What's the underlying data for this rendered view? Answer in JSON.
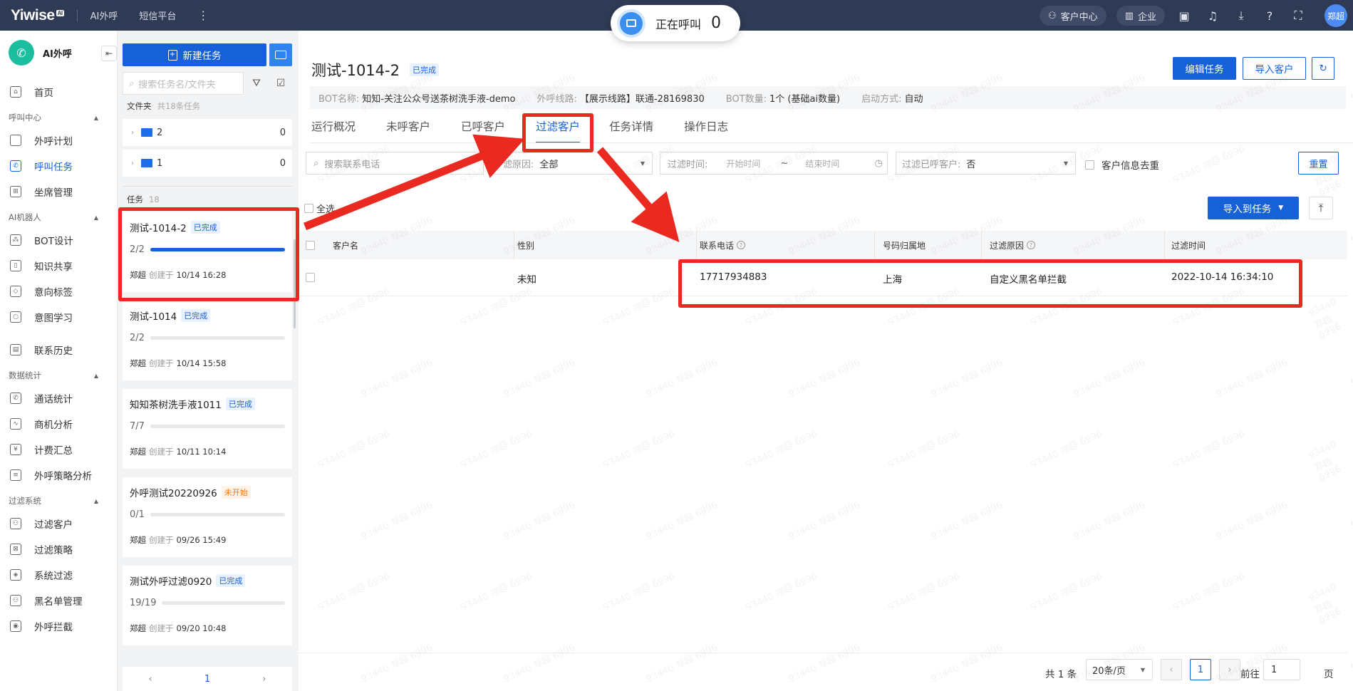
{
  "topbar": {
    "logo": "Yiwise",
    "logo_badge": "AI",
    "nav": [
      "AI外呼",
      "短信平台"
    ],
    "customer_center": "客户中心",
    "enterprise": "企业",
    "user": "郑超"
  },
  "call_status": {
    "label": "正在呼叫",
    "count": "0"
  },
  "sidebar": {
    "product": "AI外呼",
    "home": "首页",
    "groups": [
      {
        "label": "呼叫中心",
        "items": [
          "外呼计划",
          "呼叫任务",
          "坐席管理"
        ]
      },
      {
        "label": "AI机器人",
        "items": [
          "BOT设计",
          "知识共享",
          "意向标签",
          "意图学习"
        ]
      },
      {
        "label": "",
        "items": [
          "联系历史"
        ]
      },
      {
        "label": "数据统计",
        "items": [
          "通话统计",
          "商机分析",
          "计费汇总",
          "外呼策略分析"
        ]
      },
      {
        "label": "过滤系统",
        "items": [
          "过滤客户",
          "过滤策略",
          "系统过滤",
          "黑名单管理",
          "外呼拦截"
        ]
      }
    ],
    "active_item": "呼叫任务"
  },
  "task_panel": {
    "new_task": "新建任务",
    "search_placeholder": "搜索任务名/文件夹",
    "folder_label": "文件夹",
    "folder_count": "共18条任务",
    "folders": [
      {
        "name": "2",
        "count": "0"
      },
      {
        "name": "1",
        "count": "0"
      }
    ],
    "task_label": "任务",
    "task_count": "18",
    "tasks": [
      {
        "name": "测试-1014-2",
        "status": "已完成",
        "progress": "2/2",
        "ratio": 1.0,
        "creator": "郑超",
        "created_label": "创建于",
        "time": "10/14 16:28"
      },
      {
        "name": "测试-1014",
        "status": "已完成",
        "progress": "2/2",
        "ratio": 0.0,
        "creator": "郑超",
        "created_label": "创建于",
        "time": "10/14 15:58"
      },
      {
        "name": "知知茶树洗手液1011",
        "status": "已完成",
        "progress": "7/7",
        "ratio": 0.0,
        "creator": "郑超",
        "created_label": "创建于",
        "time": "10/11 10:14"
      },
      {
        "name": "外呼测试20220926",
        "status": "未开始",
        "progress": "0/1",
        "ratio": 0.0,
        "creator": "郑超",
        "created_label": "创建于",
        "time": "09/26 15:49"
      },
      {
        "name": "测试外呼过滤0920",
        "status": "已完成",
        "progress": "19/19",
        "ratio": 0.0,
        "creator": "郑超",
        "created_label": "创建于",
        "time": "09/20 10:48"
      }
    ],
    "page": "1"
  },
  "main": {
    "title": "测试-1014-2",
    "status": "已完成",
    "edit_btn": "编辑任务",
    "import_btn": "导入客户",
    "info": {
      "bot_name_label": "BOT名称:",
      "bot_name": "知知-关注公众号送茶树洗手液-demo",
      "line_label": "外呼线路:",
      "line": "【展示线路】联通-28169830",
      "bot_count_label": "BOT数量:",
      "bot_count": "1个 (基础ai数量)",
      "start_label": "启动方式:",
      "start": "自动"
    },
    "tabs": [
      "运行概况",
      "未呼客户",
      "已呼客户",
      "过滤客户",
      "任务详情",
      "操作日志"
    ],
    "active_tab": "过滤客户",
    "filters": {
      "phone_placeholder": "搜索联系电话",
      "reason_label": "滤原因:",
      "reason_value": "全部",
      "time_label": "过滤时间:",
      "time_start": "开始时间",
      "time_sep": "~",
      "time_end": "结束时间",
      "called_label": "过滤已呼客户:",
      "called_value": "否",
      "dedupe_label": "客户信息去重",
      "reset": "重置"
    },
    "select_all": "全选",
    "import_to_task": "导入到任务",
    "table": {
      "columns": [
        "客户名",
        "性别",
        "联系电话",
        "号码归属地",
        "过滤原因",
        "过滤时间"
      ],
      "rows": [
        {
          "name": "",
          "gender": "未知",
          "phone": "17717934883",
          "location": "上海",
          "reason": "自定义黑名单拦截",
          "time": "2022-10-14 16:34:10"
        }
      ]
    },
    "pagination": {
      "total": "共 1 条",
      "page_size": "20条/页",
      "current": "1",
      "goto_label": "前往",
      "goto_value": "1",
      "page_unit": "页"
    }
  },
  "watermark": "93440 郑超 6996",
  "annotation_color": "#ea2a20"
}
